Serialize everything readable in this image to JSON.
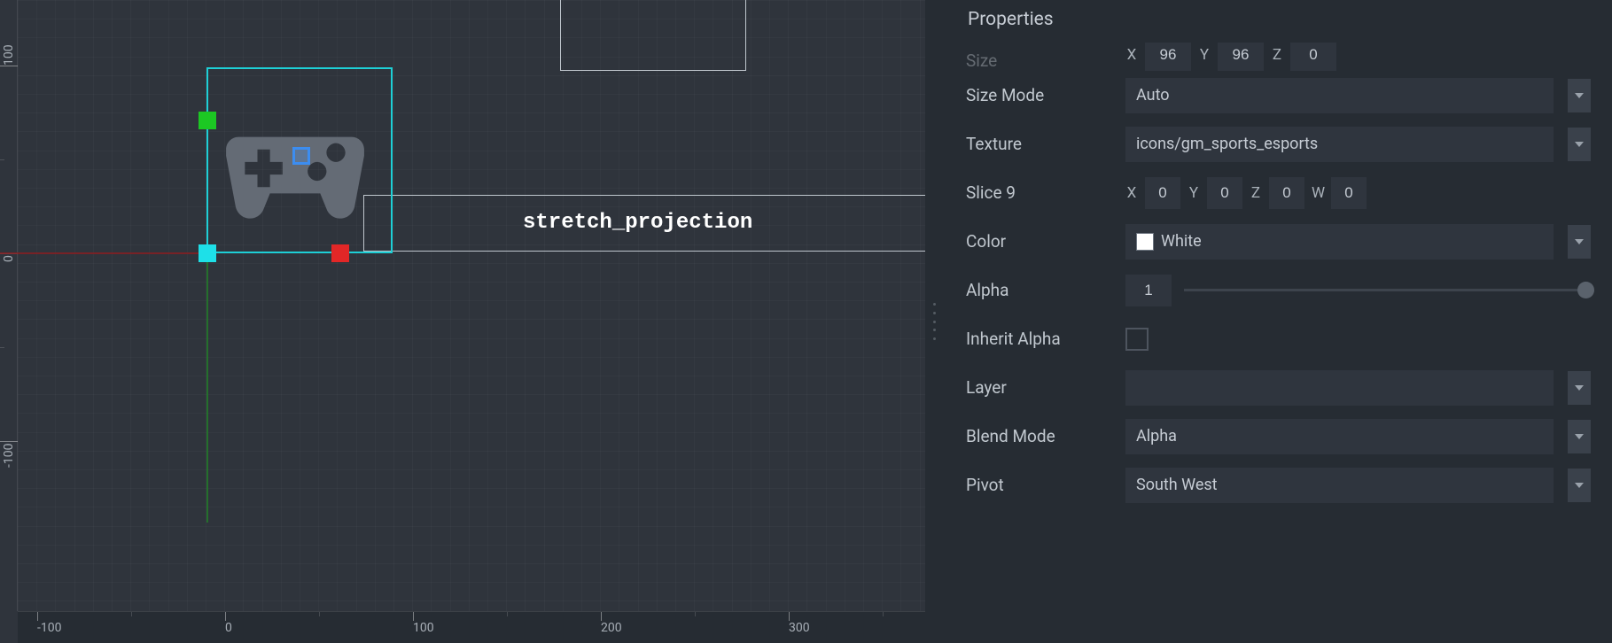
{
  "panel": {
    "title": "Properties",
    "size": {
      "label": "Size",
      "x_label": "X",
      "y_label": "Y",
      "z_label": "Z",
      "x": "96",
      "y": "96",
      "z": "0"
    },
    "size_mode": {
      "label": "Size Mode",
      "value": "Auto"
    },
    "texture": {
      "label": "Texture",
      "value": "icons/gm_sports_esports"
    },
    "slice9": {
      "label": "Slice 9",
      "x_label": "X",
      "y_label": "Y",
      "z_label": "Z",
      "w_label": "W",
      "x": "0",
      "y": "0",
      "z": "0",
      "w": "0"
    },
    "color": {
      "label": "Color",
      "value": "White",
      "hex": "#ffffff"
    },
    "alpha": {
      "label": "Alpha",
      "value": "1"
    },
    "inherit_alpha": {
      "label": "Inherit Alpha",
      "checked": false
    },
    "layer": {
      "label": "Layer",
      "value": ""
    },
    "blend_mode": {
      "label": "Blend Mode",
      "value": "Alpha"
    },
    "pivot": {
      "label": "Pivot",
      "value": "South West"
    }
  },
  "canvas": {
    "object_label": "stretch_projection",
    "ruler_x": {
      "m100": "-100",
      "p0": "0",
      "p100": "100",
      "p200": "200",
      "p300": "300"
    },
    "ruler_y": {
      "p0": "0",
      "p100": "100",
      "m100": "-100"
    }
  }
}
